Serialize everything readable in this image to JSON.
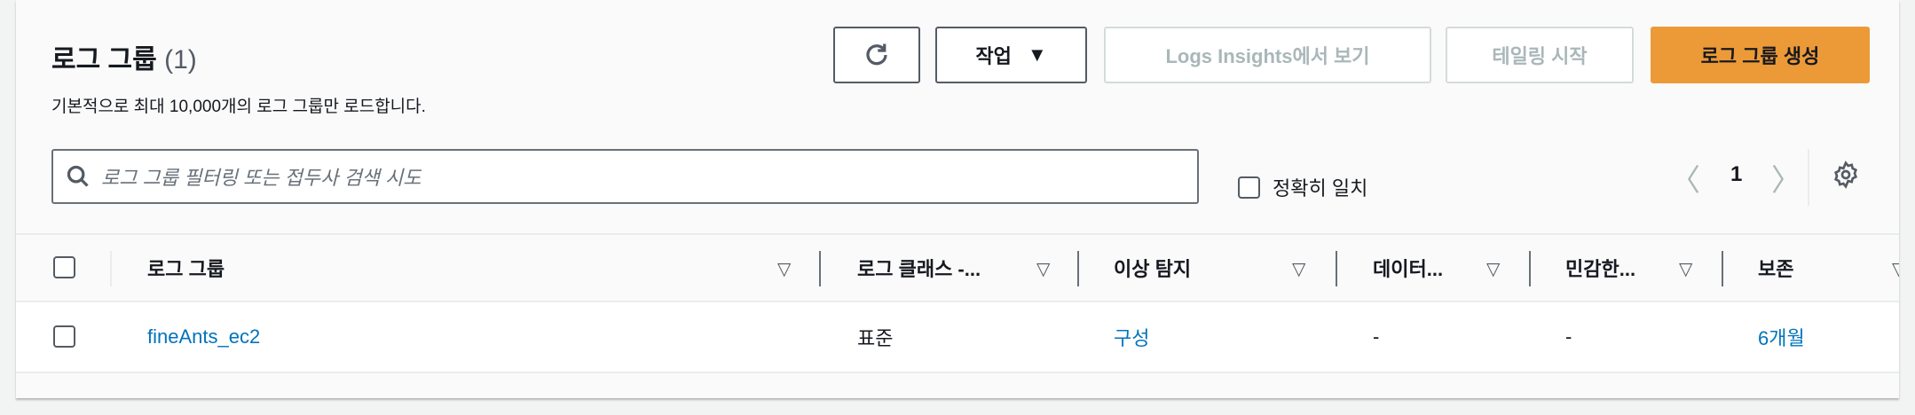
{
  "header": {
    "title": "로그 그룹",
    "count": "(1)",
    "subtitle": "기본적으로 최대 10,000개의 로그 그룹만 로드합니다."
  },
  "toolbar": {
    "actions_label": "작업",
    "logs_insights_label": "Logs Insights에서 보기",
    "tailing_label": "테일링 시작",
    "create_label": "로그 그룹 생성"
  },
  "filter": {
    "placeholder": "로그 그룹 필터링 또는 접두사 검색 시도",
    "exact_match_label": "정확히 일치"
  },
  "pagination": {
    "current_page": "1"
  },
  "table": {
    "columns": [
      "로그 그룹",
      "로그 클래스 -...",
      "이상 탐지",
      "데이터...",
      "민감한...",
      "보존"
    ],
    "rows": [
      {
        "name": "fineAnts_ec2",
        "log_class": "표준",
        "anomaly": "구성",
        "data": "-",
        "sensitive": "-",
        "retention": "6개월"
      }
    ]
  },
  "colors": {
    "primary": "#ec9a37",
    "link": "#0073bb"
  }
}
